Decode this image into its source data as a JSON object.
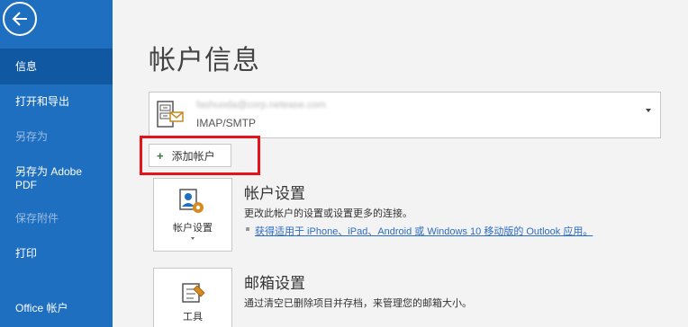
{
  "sidebar": {
    "back_icon": "back-arrow-icon",
    "items": [
      {
        "label": "信息",
        "state": "active"
      },
      {
        "label": "打开和导出",
        "state": "normal"
      },
      {
        "label": "另存为",
        "state": "disabled"
      },
      {
        "label": "另存为 Adobe PDF",
        "state": "normal"
      },
      {
        "label": "保存附件",
        "state": "disabled"
      },
      {
        "label": "打印",
        "state": "normal"
      },
      {
        "label": "Office 帐户",
        "state": "normal"
      }
    ]
  },
  "main": {
    "title": "帐户信息",
    "account": {
      "email": "fashuoda@corp.netease.com",
      "type": "IMAP/SMTP"
    },
    "add_account_label": "添加帐户",
    "account_settings": {
      "tile_label": "帐户设置",
      "title": "帐户设置",
      "description": "更改此帐户的设置或设置更多的连接。",
      "link": "获得适用于 iPhone、iPad、Android 或 Windows 10 移动版的 Outlook 应用。"
    },
    "mailbox_settings": {
      "tile_label": "工具",
      "title": "邮箱设置",
      "description": "通过清空已删除项目并存档，来管理您的邮箱大小。"
    }
  },
  "colors": {
    "sidebar_bg": "#1e6fbf",
    "sidebar_active": "#1158a3",
    "highlight": "#e5141a",
    "link": "#2a6cc4"
  }
}
